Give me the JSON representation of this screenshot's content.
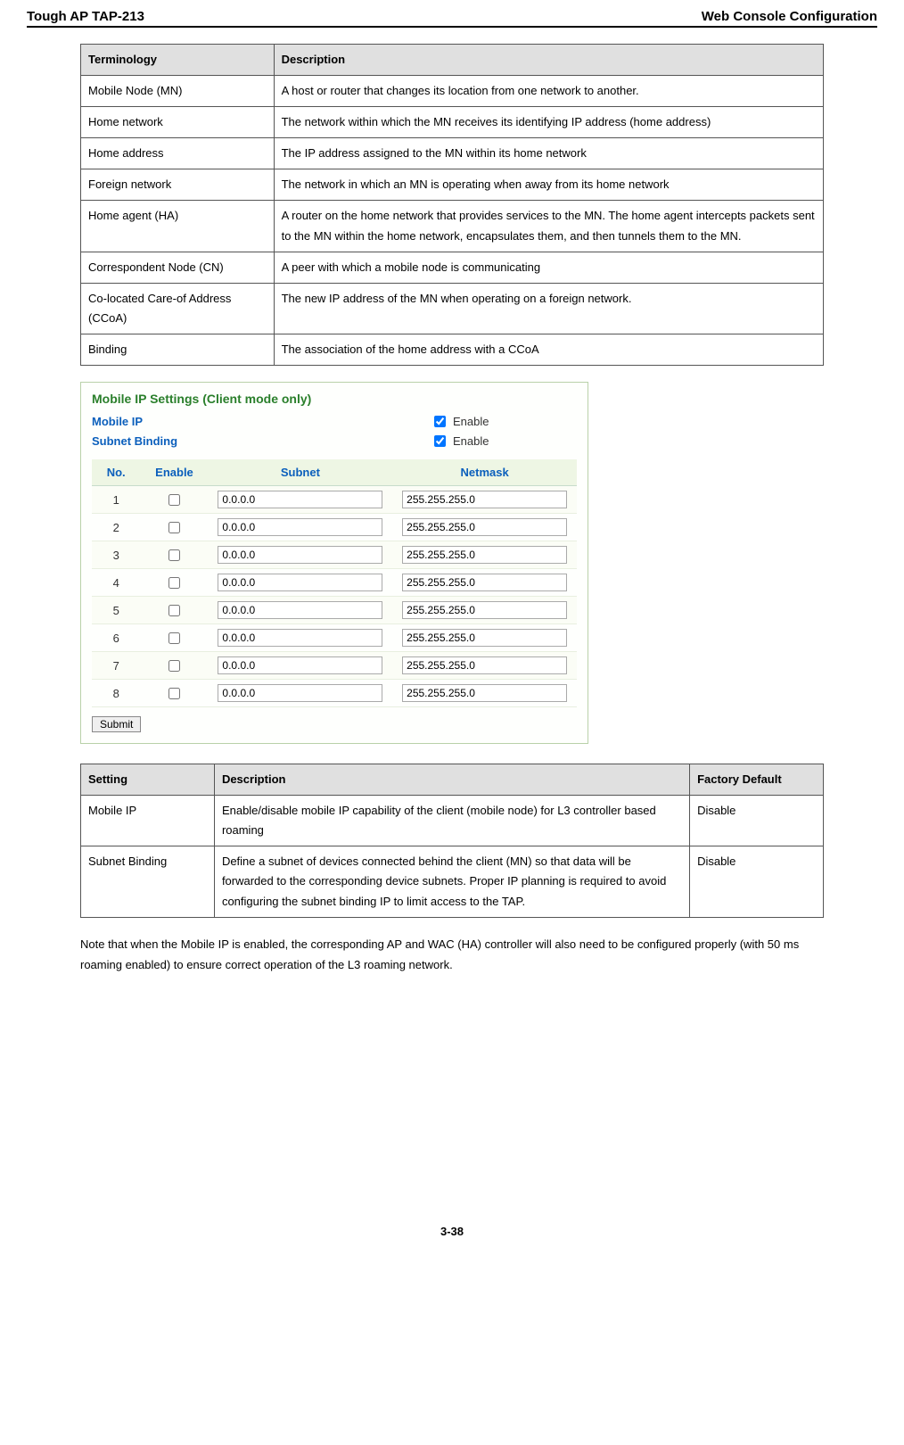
{
  "header": {
    "left": "Tough AP TAP-213",
    "right": "Web Console Configuration"
  },
  "termTable": {
    "headers": [
      "Terminology",
      "Description"
    ],
    "rows": [
      [
        "Mobile Node (MN)",
        "A host or router that changes its location from one network to another."
      ],
      [
        "Home network",
        "The network within which the MN receives its identifying IP address (home address)"
      ],
      [
        "Home address",
        "The IP address assigned to the MN within its home network"
      ],
      [
        "Foreign network",
        "The network in which an MN is operating when away from its home network"
      ],
      [
        "Home agent (HA)",
        "A router on the home network that provides services to the MN. The home agent intercepts packets sent to the MN within the home network, encapsulates them, and then tunnels them to the MN."
      ],
      [
        "Correspondent Node (CN)",
        "A peer with which a mobile node is communicating"
      ],
      [
        "Co-located Care-of Address (CCoA)",
        "The new IP address of the MN when operating on a foreign network."
      ],
      [
        "Binding",
        "The association of the home address with a CCoA"
      ]
    ]
  },
  "panel": {
    "title": "Mobile IP Settings  (Client mode only)",
    "mobileIpLabel": "Mobile IP",
    "subnetBindingLabel": "Subnet Binding",
    "enableText": "Enable",
    "mobileIpChecked": true,
    "subnetBindingChecked": true,
    "subnetHeaders": [
      "No.",
      "Enable",
      "Subnet",
      "Netmask"
    ],
    "subnetRows": [
      {
        "no": "1",
        "enabled": false,
        "subnet": "0.0.0.0",
        "netmask": "255.255.255.0"
      },
      {
        "no": "2",
        "enabled": false,
        "subnet": "0.0.0.0",
        "netmask": "255.255.255.0"
      },
      {
        "no": "3",
        "enabled": false,
        "subnet": "0.0.0.0",
        "netmask": "255.255.255.0"
      },
      {
        "no": "4",
        "enabled": false,
        "subnet": "0.0.0.0",
        "netmask": "255.255.255.0"
      },
      {
        "no": "5",
        "enabled": false,
        "subnet": "0.0.0.0",
        "netmask": "255.255.255.0"
      },
      {
        "no": "6",
        "enabled": false,
        "subnet": "0.0.0.0",
        "netmask": "255.255.255.0"
      },
      {
        "no": "7",
        "enabled": false,
        "subnet": "0.0.0.0",
        "netmask": "255.255.255.0"
      },
      {
        "no": "8",
        "enabled": false,
        "subnet": "0.0.0.0",
        "netmask": "255.255.255.0"
      }
    ],
    "submit": "Submit"
  },
  "settingTable": {
    "headers": [
      "Setting",
      "Description",
      "Factory Default"
    ],
    "rows": [
      [
        "Mobile IP",
        "Enable/disable mobile IP capability of the client (mobile node) for L3 controller based roaming",
        "Disable"
      ],
      [
        "Subnet Binding",
        "Define a subnet of devices connected behind the client (MN) so that data will be forwarded to the corresponding device subnets. Proper IP planning is required to avoid configuring the subnet binding IP to limit access to the TAP.",
        "Disable"
      ]
    ]
  },
  "note": "Note that when the Mobile IP is enabled, the corresponding AP and WAC (HA) controller will also need to be configured properly (with 50 ms roaming enabled) to ensure correct operation of the L3 roaming network.",
  "pageNumber": "3-38"
}
